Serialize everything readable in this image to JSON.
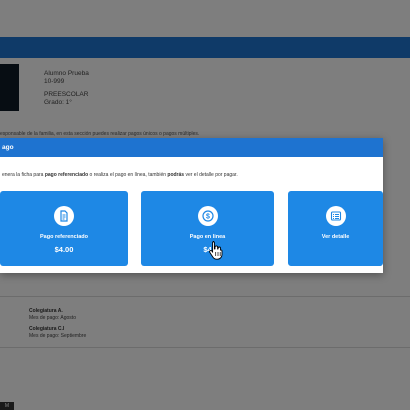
{
  "background": {
    "student_name": "Alumno Prueba",
    "student_code": "10-999",
    "level": "PREESCOLAR",
    "grade": "Grado: 1°",
    "intro_text": "esponsable de la familia, en esta sección puedes realizar pagos únicos o pagos múltiples.",
    "categories": [
      {
        "title": "Colegiatura A.",
        "subtitle": "Mes de pago: Agosto"
      },
      {
        "title": "Colegiatura C.I",
        "subtitle": "Mes de pago: Septiembre"
      }
    ],
    "corner_badge": "M"
  },
  "modal": {
    "title": "ago",
    "desc_pre": "enera la ficha para ",
    "desc_b1": "pago referenciado",
    "desc_mid": " o realiza el pago en línea, también ",
    "desc_b2": "podrás",
    "desc_post": " ver el detalle por pagar.",
    "options": [
      {
        "label": "Pago referenciado",
        "amount": "$4.00",
        "icon": "document-icon"
      },
      {
        "label": "Pago en linea",
        "amount": "$4",
        "icon": "dollar-coin-icon"
      },
      {
        "label": "Ver detalle",
        "amount": "",
        "icon": "list-icon"
      }
    ]
  },
  "colors": {
    "accent": "#1e73d0",
    "button": "#1e88e5",
    "overlay": "rgba(0,0,0,0.5)"
  }
}
